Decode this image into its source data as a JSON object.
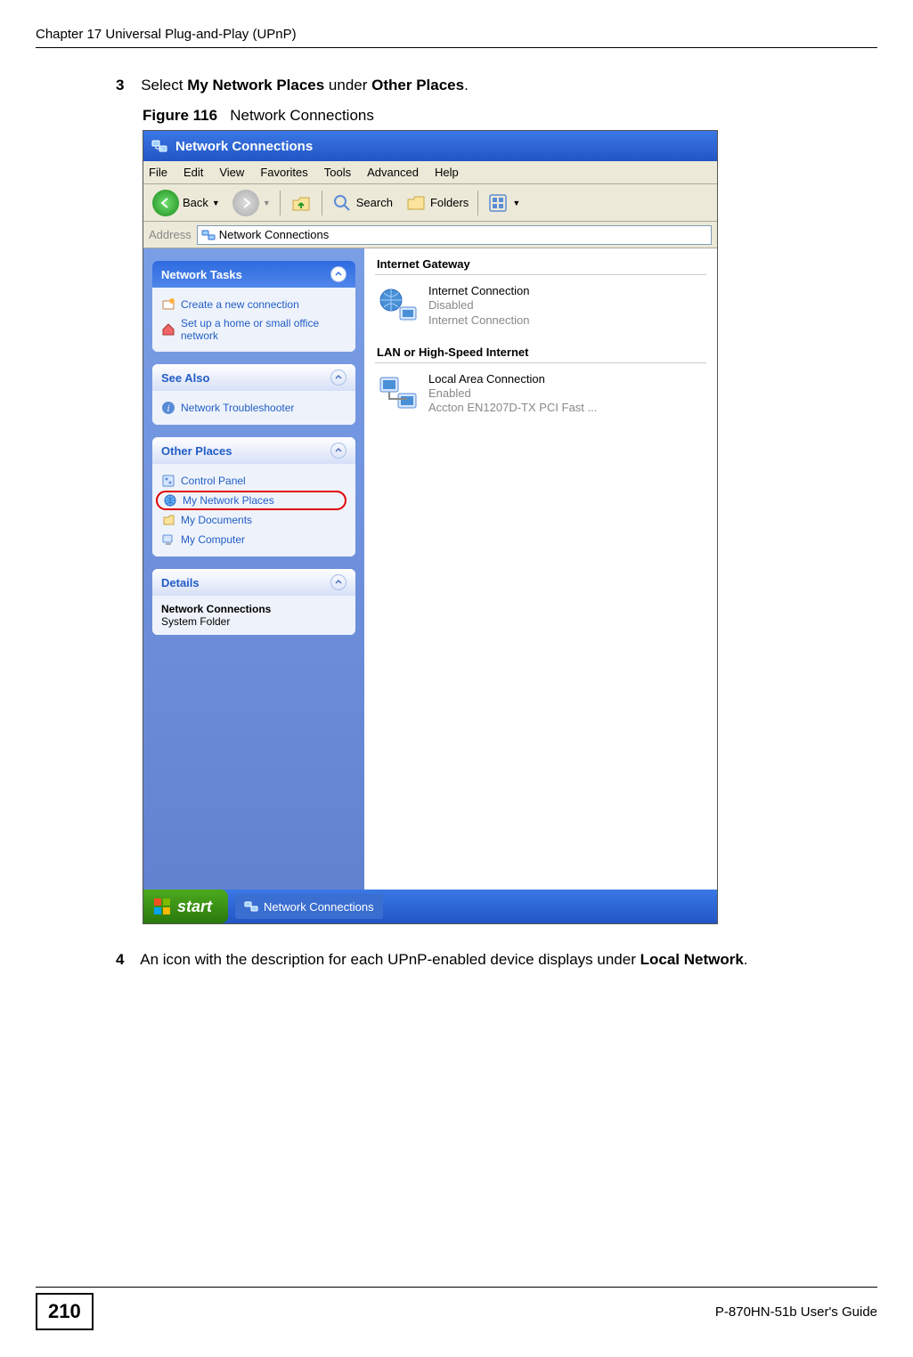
{
  "chapter_header": "Chapter 17 Universal Plug-and-Play (UPnP)",
  "step3": {
    "num": "3",
    "pre": "Select ",
    "bold1": "My Network Places",
    "mid": " under ",
    "bold2": "Other Places",
    "post": "."
  },
  "figure": {
    "label": "Figure 116",
    "caption": "Network Connections"
  },
  "window": {
    "title": "Network Connections",
    "menus": [
      "File",
      "Edit",
      "View",
      "Favorites",
      "Tools",
      "Advanced",
      "Help"
    ],
    "toolbar": {
      "back": "Back",
      "search": "Search",
      "folders": "Folders"
    },
    "address_label": "Address",
    "address_value": "Network Connections",
    "left": {
      "network_tasks": {
        "title": "Network Tasks",
        "items": [
          "Create a new connection",
          "Set up a home or small office network"
        ]
      },
      "see_also": {
        "title": "See Also",
        "items": [
          "Network Troubleshooter"
        ]
      },
      "other_places": {
        "title": "Other Places",
        "items": [
          "Control Panel",
          "My Network Places",
          "My Documents",
          "My Computer"
        ]
      },
      "details": {
        "title": "Details",
        "line1": "Network Connections",
        "line2": "System Folder"
      }
    },
    "right": {
      "cat1": "Internet Gateway",
      "conn1": {
        "name": "Internet Connection",
        "status": "Disabled",
        "via": "Internet Connection"
      },
      "cat2": "LAN or High-Speed Internet",
      "conn2": {
        "name": "Local Area Connection",
        "status": "Enabled",
        "via": "Accton EN1207D-TX PCI Fast ..."
      }
    },
    "taskbar": {
      "start": "start",
      "item": "Network Connections"
    }
  },
  "step4": {
    "num": "4",
    "pre": "An icon with the description for each UPnP-enabled device displays under ",
    "bold": "Local Network",
    "post": "."
  },
  "footer": {
    "page": "210",
    "guide": "P-870HN-51b User's Guide"
  }
}
